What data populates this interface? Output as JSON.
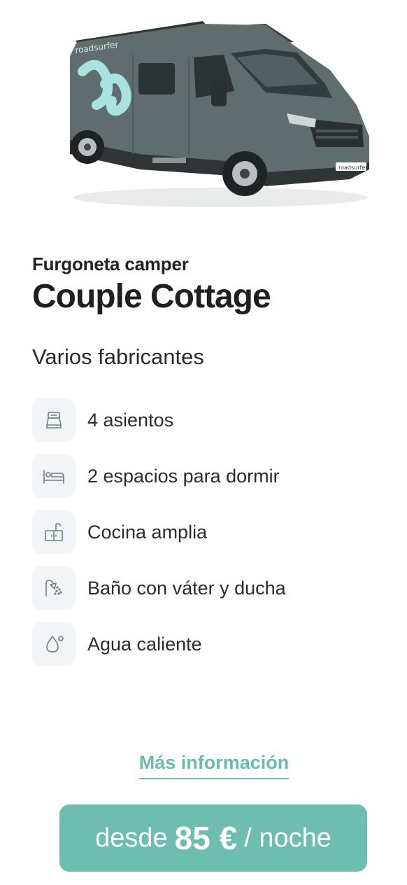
{
  "vehicle": {
    "category": "Furgoneta camper",
    "name": "Couple Cottage",
    "maker": "Varios fabricantes",
    "brand_text": "roadsurfer",
    "image_icon": "camper-van-image"
  },
  "features": [
    {
      "icon": "seat-icon",
      "label": "4 asientos"
    },
    {
      "icon": "bed-icon",
      "label": "2 espacios para dormir"
    },
    {
      "icon": "kitchen-sink-icon",
      "label": "Cocina amplia"
    },
    {
      "icon": "shower-icon",
      "label": "Baño con váter y ducha"
    },
    {
      "icon": "water-drop-icon",
      "label": "Agua caliente"
    }
  ],
  "more_info_label": "Más información",
  "price": {
    "prefix": "desde",
    "amount": "85 €",
    "suffix": "/ noche"
  },
  "colors": {
    "accent": "#6ebeaf",
    "link": "#6bbcae",
    "van_body": "#5d6b6c",
    "icon_bg": "#f2f5f7"
  }
}
